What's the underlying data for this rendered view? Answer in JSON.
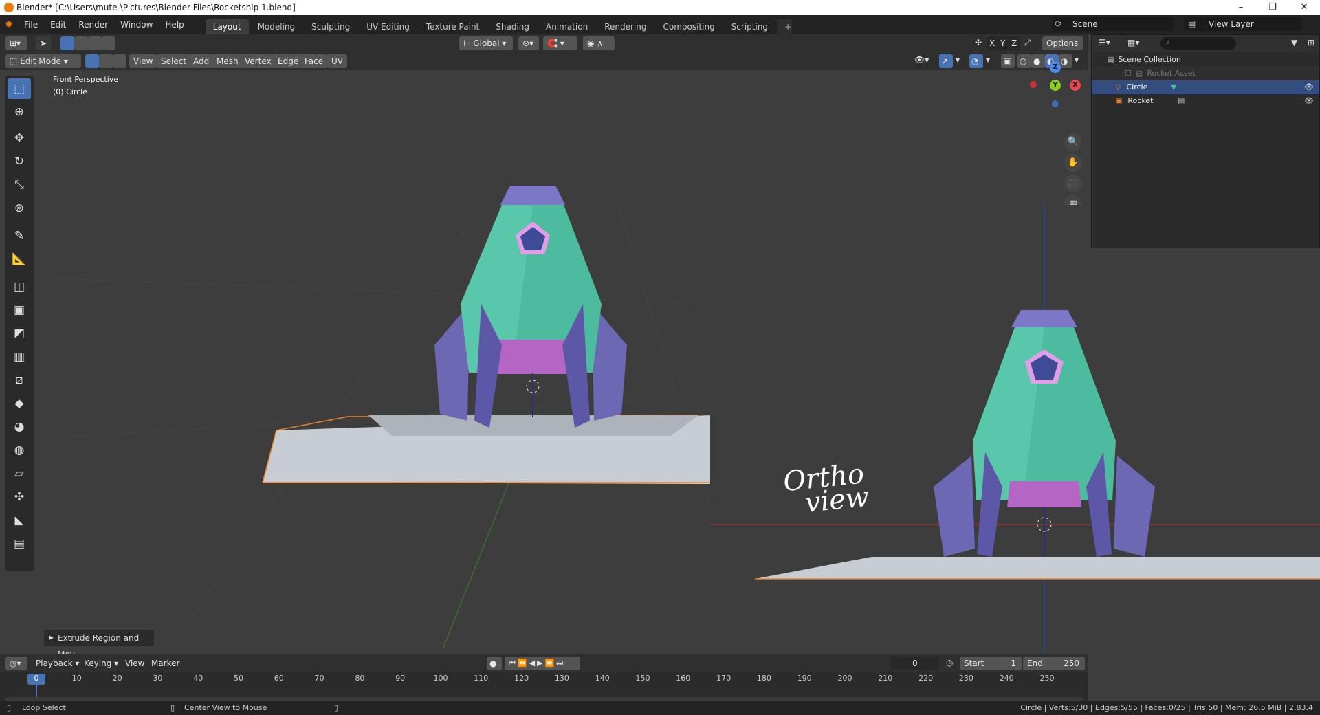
{
  "window": {
    "title": "Blender* [C:\\Users\\mute-\\Pictures\\Blender Files\\Rocketship 1.blend]",
    "controls": [
      "–",
      "❐",
      "✕"
    ]
  },
  "menu": [
    "File",
    "Edit",
    "Render",
    "Window",
    "Help"
  ],
  "workspaces": [
    "Layout",
    "Modeling",
    "Sculpting",
    "UV Editing",
    "Texture Paint",
    "Shading",
    "Animation",
    "Rendering",
    "Compositing",
    "Scripting"
  ],
  "active_workspace": "Layout",
  "scene": {
    "name": "Scene",
    "view_layer": "View Layer"
  },
  "header": {
    "mode": "Edit Mode",
    "menus": [
      "View",
      "Select",
      "Add",
      "Mesh",
      "Vertex",
      "Edge",
      "Face",
      "UV"
    ],
    "orientation": "Global",
    "axes": [
      "X",
      "Y",
      "Z"
    ],
    "options": "Options"
  },
  "viewport": {
    "view_name": "Front Perspective",
    "object_name": "(0) Circle",
    "annotation_line1": "Ortho",
    "annotation_line2": "view"
  },
  "gizmo": {
    "z": "Z",
    "y": "Y",
    "x": "X"
  },
  "last_operator": "Extrude Region and Mov",
  "outliner": {
    "collection": "Scene Collection",
    "items": [
      {
        "name": "Rocket Asset",
        "disabled": true
      },
      {
        "name": "Circle",
        "selected": true
      },
      {
        "name": "Rocket",
        "selected": false
      }
    ]
  },
  "timeline": {
    "menus": [
      "Playback",
      "Keying",
      "View",
      "Marker"
    ],
    "current_frame": "0",
    "start_label": "Start",
    "start": "1",
    "end_label": "End",
    "end": "250",
    "ticks": [
      "0",
      "10",
      "20",
      "30",
      "40",
      "50",
      "60",
      "70",
      "80",
      "90",
      "100",
      "110",
      "120",
      "130",
      "140",
      "150",
      "160",
      "170",
      "180",
      "190",
      "200",
      "210",
      "220",
      "230",
      "240",
      "250"
    ]
  },
  "status": {
    "left": "Loop Select",
    "middle": "Center View to Mouse",
    "right": "Circle | Verts:5/30 | Edges:5/55 | Faces:0/25 | Tris:50 | Mem: 26.5 MiB | 2.83.4"
  },
  "colors": {
    "accent": "#4772b3",
    "rocket_body": "#4dbc9e",
    "rocket_fins": "#6d68b4",
    "rocket_nozzle": "#b366c4",
    "window": "#3f4b96",
    "selection": "#e8822b"
  }
}
